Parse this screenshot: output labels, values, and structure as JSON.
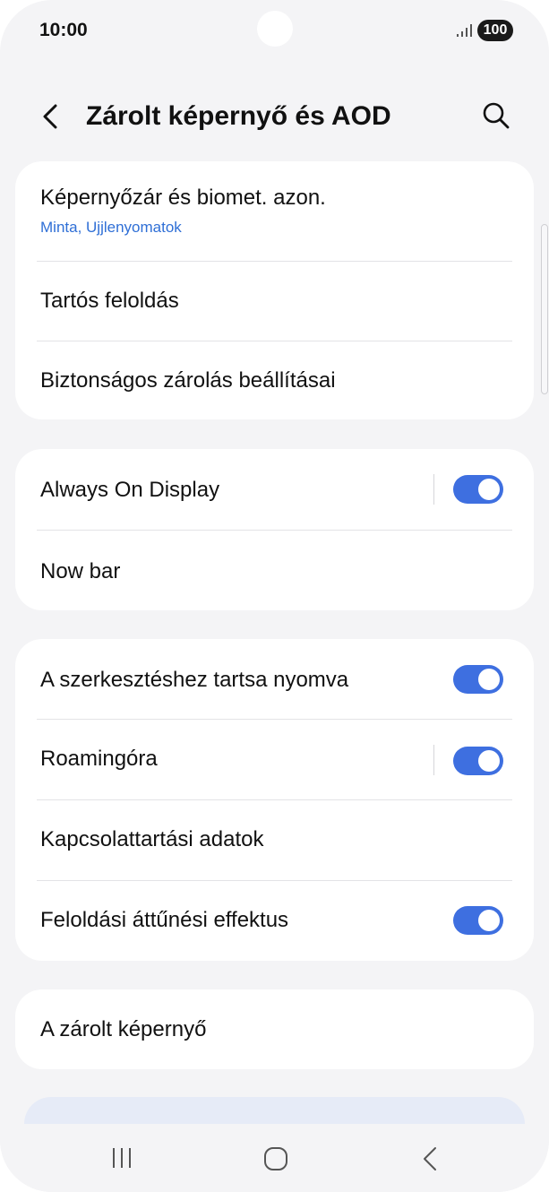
{
  "status_bar": {
    "time": "10:00",
    "battery": "100",
    "signal_icon": "signal-bars-icon"
  },
  "header": {
    "title": "Zárolt képernyő és AOD",
    "back_icon": "back-chevron-icon",
    "search_icon": "search-icon"
  },
  "card1": {
    "items": [
      {
        "label": "Képernyőzár és biomet. azon.",
        "sub": "Minta, Ujjlenyomatok"
      },
      {
        "label": "Tartós feloldás"
      },
      {
        "label": "Biztonságos zárolás beállításai"
      }
    ]
  },
  "card2": {
    "items": [
      {
        "label": "Always On Display",
        "toggle": true
      },
      {
        "label": "Now bar"
      }
    ]
  },
  "card3": {
    "items": [
      {
        "label": "A szerkesztéshez tartsa nyomva",
        "toggle": true
      },
      {
        "label": "Roamingóra",
        "toggle": true
      },
      {
        "label": "Kapcsolattartási adatok"
      },
      {
        "label": "Feloldási áttűnési effektus",
        "toggle": true
      }
    ]
  },
  "card4": {
    "items": [
      {
        "label": "A zárolt képernyő"
      }
    ]
  },
  "colors": {
    "accent": "#3e6fe0",
    "subtitle": "#2f6fd6",
    "background": "#f4f4f6"
  },
  "navbar": {
    "recents_icon": "recents-icon",
    "home_icon": "home-icon",
    "back_icon": "nav-back-icon"
  }
}
